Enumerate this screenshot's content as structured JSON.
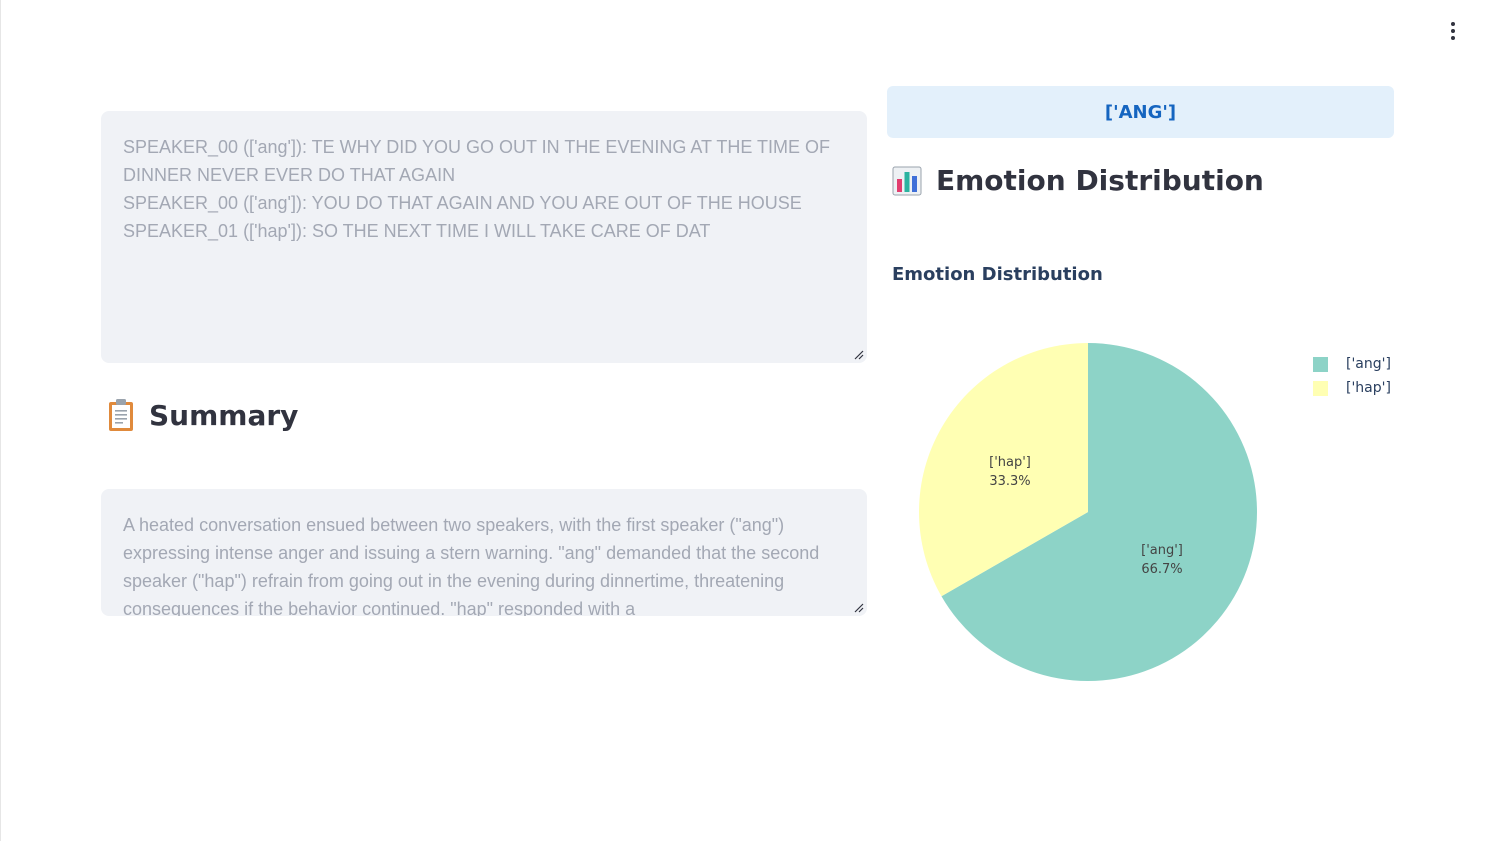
{
  "menu": {
    "icon": "kebab-menu-icon"
  },
  "transcript": {
    "lines": [
      "SPEAKER_00 (['ang']): TE WHY DID YOU GO OUT IN THE EVENING AT THE TIME OF DINNER NEVER EVER DO THAT AGAIN",
      "SPEAKER_00 (['ang']): YOU DO THAT AGAIN AND YOU ARE OUT OF THE HOUSE",
      "SPEAKER_01 (['hap']): SO THE NEXT TIME I WILL TAKE CARE OF DAT"
    ]
  },
  "summary": {
    "header": "Summary",
    "icon": "clipboard-icon",
    "text": "A heated conversation ensued between two speakers, with the first speaker (\"ang\") expressing intense anger and issuing a stern warning. \"ang\" demanded that the second speaker (\"hap\") refrain from going out in the evening during dinnertime, threatening consequences if the behavior continued. \"hap\" responded with a"
  },
  "banner": {
    "text": "['ANG']"
  },
  "distribution": {
    "header": "Emotion Distribution",
    "icon": "bar-chart-icon"
  },
  "chart_data": {
    "type": "pie",
    "title": "Emotion Distribution",
    "slices": [
      {
        "label": "['ang']",
        "value": 66.7,
        "percent_text": "66.7%",
        "color": "#8dd3c7"
      },
      {
        "label": "['hap']",
        "value": 33.3,
        "percent_text": "33.3%",
        "color": "#ffffb3"
      }
    ],
    "legend_position": "top-right"
  }
}
